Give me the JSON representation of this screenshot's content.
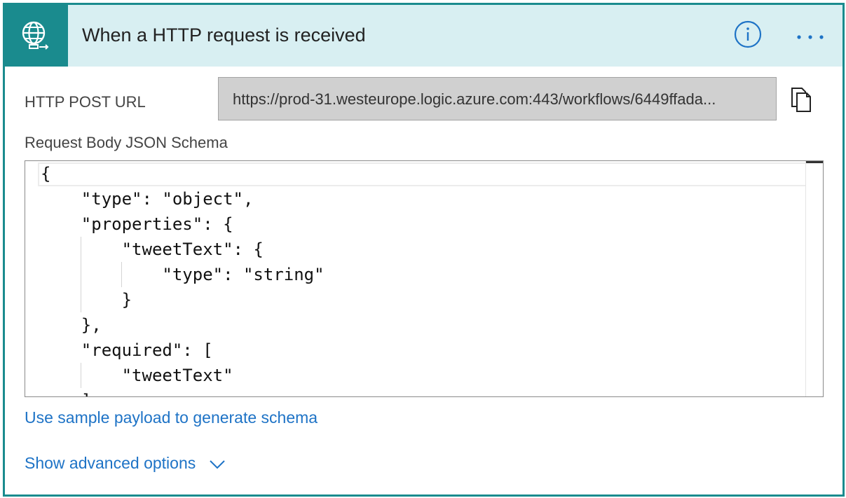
{
  "header": {
    "title": "When a HTTP request is received",
    "icon": "globe-request-icon",
    "accent_color": "#1a8b8e",
    "background_color": "#d8eff2"
  },
  "url": {
    "label": "HTTP POST URL",
    "value": "https://prod-31.westeurope.logic.azure.com:443/workflows/6449ffada..."
  },
  "schema": {
    "label": "Request Body JSON Schema",
    "lines": [
      "{",
      "    \"type\": \"object\",",
      "    \"properties\": {",
      "        \"tweetText\": {",
      "            \"type\": \"string\"",
      "        }",
      "    },",
      "    \"required\": [",
      "        \"tweetText\"",
      "    ]"
    ]
  },
  "links": {
    "sample_payload": "Use sample payload to generate schema",
    "advanced": "Show advanced options"
  },
  "link_color": "#1e73c6"
}
